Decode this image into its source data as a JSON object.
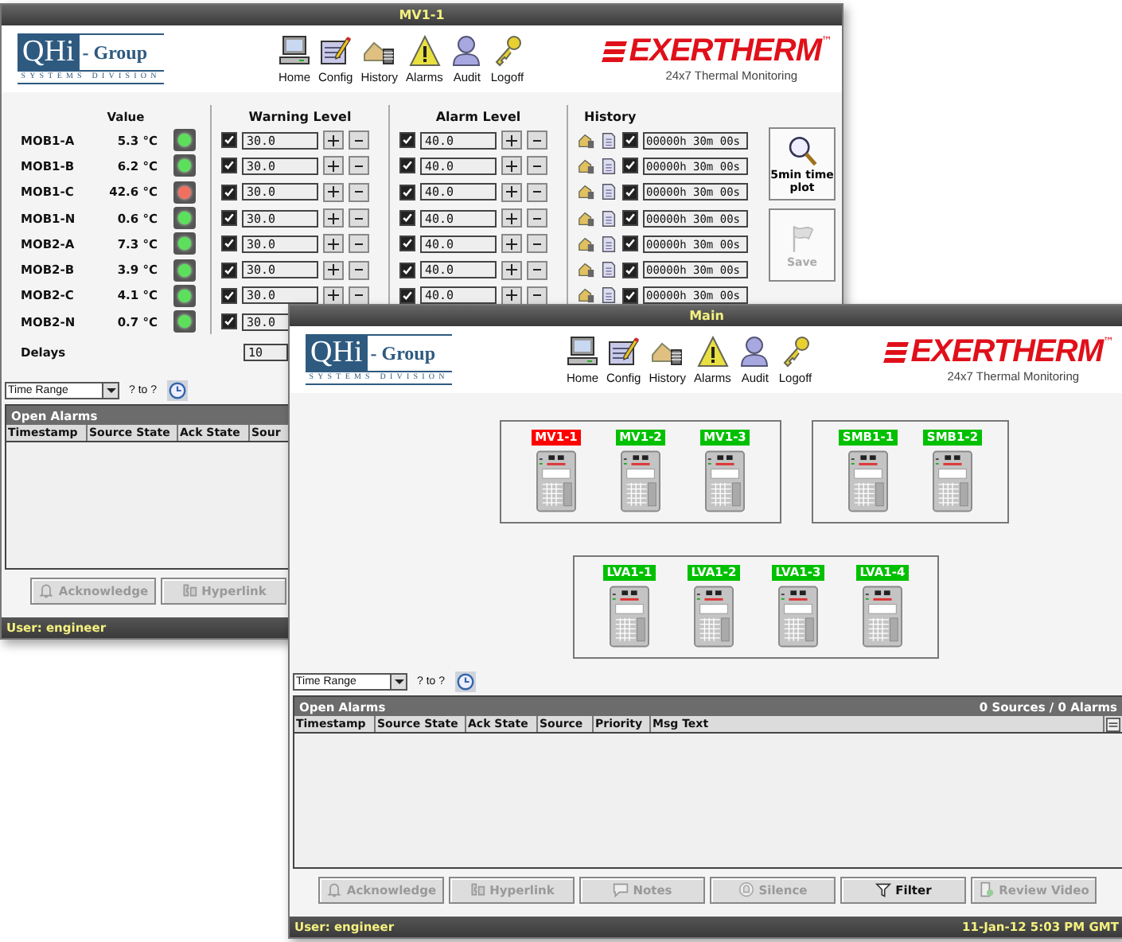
{
  "windows": [
    {
      "kind": "sensor_detail",
      "title": "MV1-1",
      "header": {
        "logo": {
          "main": "QHi",
          "suffix": "- Group",
          "division": "SYSTEMS DIVISION"
        },
        "nav": [
          {
            "label": "Home"
          },
          {
            "label": "Config"
          },
          {
            "label": "History"
          },
          {
            "label": "Alarms"
          },
          {
            "label": "Audit"
          },
          {
            "label": "Logoff"
          }
        ],
        "brand": {
          "name": "EXERTHERM",
          "mark": "™",
          "tagline": "24x7 Thermal Monitoring"
        }
      },
      "sensor_columns": {
        "value": "Value",
        "warning": "Warning Level",
        "alarm": "Alarm Level",
        "history": "History"
      },
      "sensors": [
        {
          "name": "MOB1-A",
          "value": "5.3 °C",
          "alarm": false,
          "warning_level": {
            "checked": true,
            "value": "30.0"
          },
          "alarm_level": {
            "checked": true,
            "value": "40.0"
          },
          "history": {
            "checked": true,
            "duration": "00000h 30m 00s"
          }
        },
        {
          "name": "MOB1-B",
          "value": "6.2 °C",
          "alarm": false,
          "warning_level": {
            "checked": true,
            "value": "30.0"
          },
          "alarm_level": {
            "checked": true,
            "value": "40.0"
          },
          "history": {
            "checked": true,
            "duration": "00000h 30m 00s"
          }
        },
        {
          "name": "MOB1-C",
          "value": "42.6 °C",
          "alarm": true,
          "warning_level": {
            "checked": true,
            "value": "30.0"
          },
          "alarm_level": {
            "checked": true,
            "value": "40.0"
          },
          "history": {
            "checked": true,
            "duration": "00000h 30m 00s"
          }
        },
        {
          "name": "MOB1-N",
          "value": "0.6 °C",
          "alarm": false,
          "warning_level": {
            "checked": true,
            "value": "30.0"
          },
          "alarm_level": {
            "checked": true,
            "value": "40.0"
          },
          "history": {
            "checked": true,
            "duration": "00000h 30m 00s"
          }
        },
        {
          "name": "MOB2-A",
          "value": "7.3 °C",
          "alarm": false,
          "warning_level": {
            "checked": true,
            "value": "30.0"
          },
          "alarm_level": {
            "checked": true,
            "value": "40.0"
          },
          "history": {
            "checked": true,
            "duration": "00000h 30m 00s"
          }
        },
        {
          "name": "MOB2-B",
          "value": "3.9 °C",
          "alarm": false,
          "warning_level": {
            "checked": true,
            "value": "30.0"
          },
          "alarm_level": {
            "checked": true,
            "value": "40.0"
          },
          "history": {
            "checked": true,
            "duration": "00000h 30m 00s"
          }
        },
        {
          "name": "MOB2-C",
          "value": "4.1 °C",
          "alarm": false,
          "warning_level": {
            "checked": true,
            "value": "30.0"
          },
          "alarm_level": {
            "checked": true,
            "value": "40.0"
          },
          "history": {
            "checked": true,
            "duration": "00000h 30m 00s"
          }
        },
        {
          "name": "MOB2-N",
          "value": "0.7 °C",
          "alarm": false,
          "warning_level": {
            "checked": true,
            "value": "30.0"
          }
        }
      ],
      "side_buttons": [
        {
          "label": "5min time plot",
          "disabled": false
        },
        {
          "label": "Save",
          "disabled": true
        }
      ],
      "delays": {
        "label": "Delays",
        "value": "10"
      },
      "time_filter": {
        "range": "Time Range",
        "span": "? to ?"
      },
      "alarms": {
        "title": "Open Alarms",
        "columns": [
          "Timestamp",
          "Source State",
          "Ack State",
          "Sour"
        ]
      },
      "buttons": [
        {
          "label": "Acknowledge",
          "disabled": true
        },
        {
          "label": "Hyperlink",
          "disabled": true
        }
      ],
      "status": {
        "user": "User: engineer"
      }
    },
    {
      "kind": "site_overview",
      "title": "Main",
      "header": {
        "logo": {
          "main": "QHi",
          "suffix": "- Group",
          "division": "SYSTEMS DIVISION"
        },
        "nav": [
          {
            "label": "Home"
          },
          {
            "label": "Config"
          },
          {
            "label": "History"
          },
          {
            "label": "Alarms"
          },
          {
            "label": "Audit"
          },
          {
            "label": "Logoff"
          }
        ],
        "brand": {
          "name": "EXERTHERM",
          "mark": "™",
          "tagline": "24x7 Thermal Monitoring"
        }
      },
      "diagram": {
        "rows": [
          {
            "groups": [
              {
                "devices": [
                  {
                    "name": "MV1-1",
                    "color": "#ff0000"
                  },
                  {
                    "name": "MV1-2",
                    "color": "#00c000"
                  },
                  {
                    "name": "MV1-3",
                    "color": "#00c000"
                  }
                ]
              },
              {
                "devices": [
                  {
                    "name": "SMB1-1",
                    "color": "#00c000"
                  },
                  {
                    "name": "SMB1-2",
                    "color": "#00c000"
                  }
                ]
              }
            ]
          },
          {
            "groups": [
              {
                "devices": [
                  {
                    "name": "LVA1-1",
                    "color": "#00c000"
                  },
                  {
                    "name": "LVA1-2",
                    "color": "#00c000"
                  },
                  {
                    "name": "LVA1-3",
                    "color": "#00c000"
                  },
                  {
                    "name": "LVA1-4",
                    "color": "#00c000"
                  }
                ]
              }
            ]
          }
        ]
      },
      "time_filter": {
        "range": "Time Range",
        "span": "? to ?"
      },
      "alarms": {
        "title": "Open Alarms",
        "summary": "0 Sources / 0 Alarms",
        "columns": [
          "Timestamp",
          "Source State",
          "Ack State",
          "Source",
          "Priority",
          "Msg Text"
        ]
      },
      "buttons": [
        {
          "label": "Acknowledge",
          "disabled": true
        },
        {
          "label": "Hyperlink",
          "disabled": true
        },
        {
          "label": "Notes",
          "disabled": true
        },
        {
          "label": "Silence",
          "disabled": true
        },
        {
          "label": "Filter",
          "disabled": false
        },
        {
          "label": "Review Video",
          "disabled": true
        }
      ],
      "status": {
        "user": "User: engineer",
        "datetime": "11-Jan-12 5:03 PM GMT"
      }
    }
  ]
}
